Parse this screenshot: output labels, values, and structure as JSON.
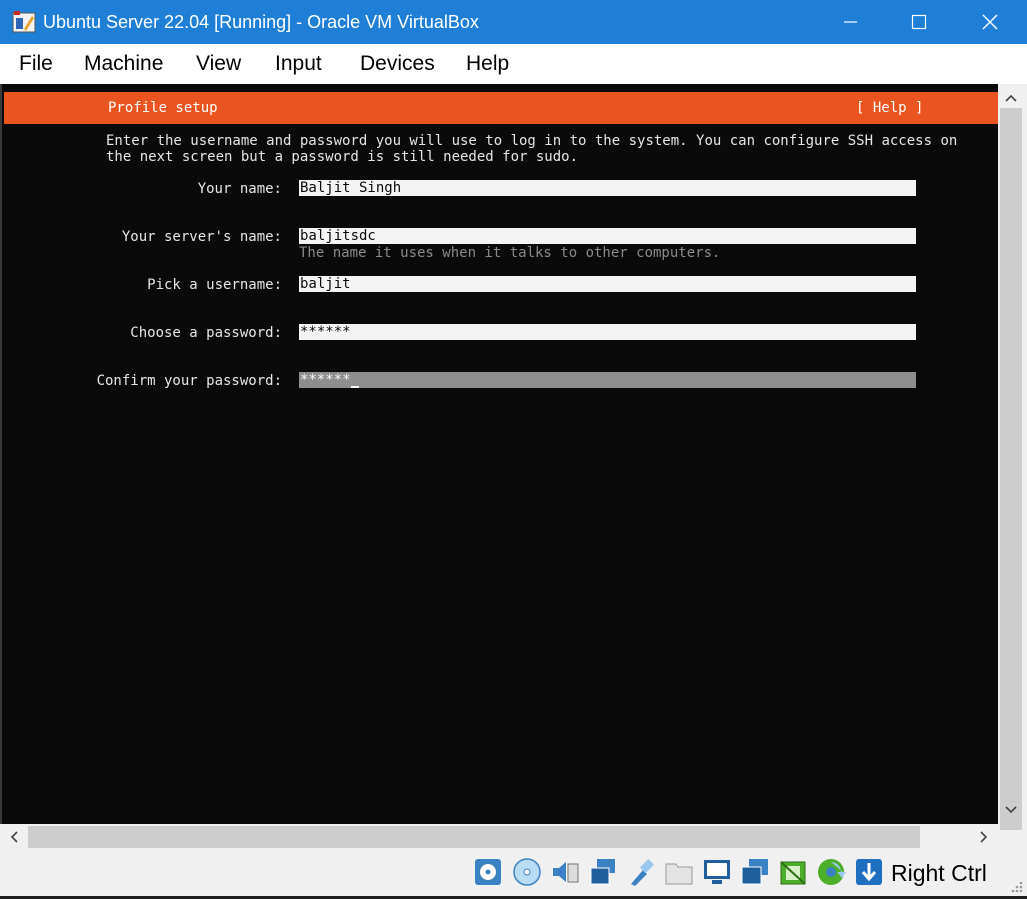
{
  "window": {
    "title": "Ubuntu Server 22.04 [Running] - Oracle VM VirtualBox",
    "titlebar_color": "#1f7fd6"
  },
  "menu": {
    "items": [
      {
        "label": "File"
      },
      {
        "label": "Machine"
      },
      {
        "label": "View"
      },
      {
        "label": "Input"
      },
      {
        "label": "Devices"
      },
      {
        "label": "Help"
      }
    ]
  },
  "installer": {
    "header_title": "Profile setup",
    "header_help": "[ Help ]",
    "accent_color": "#e95420",
    "intro_line1": "Enter the username and password you will use to log in to the system. You can configure SSH access on",
    "intro_line2": "the next screen but a password is still needed for sudo.",
    "fields": [
      {
        "label": "Your name:",
        "value": "Baljit Singh"
      },
      {
        "label": "Your server's name:",
        "value": "baljitsdc",
        "hint": "The name it uses when it talks to other computers."
      },
      {
        "label": "Pick a username:",
        "value": "baljit"
      },
      {
        "label": "Choose a password:",
        "value": "******"
      },
      {
        "label": "Confirm your password:",
        "value": "******",
        "focused": true
      }
    ]
  },
  "statusbar": {
    "icons": [
      "hard-disk-icon",
      "optical-drive-icon",
      "audio-icon",
      "network-icon",
      "usb-icon",
      "shared-folders-icon",
      "display-icon",
      "video-capture-icon",
      "recording-icon",
      "cpu-execution-icon",
      "mouse-integration-icon"
    ],
    "host_key": "Right Ctrl"
  }
}
